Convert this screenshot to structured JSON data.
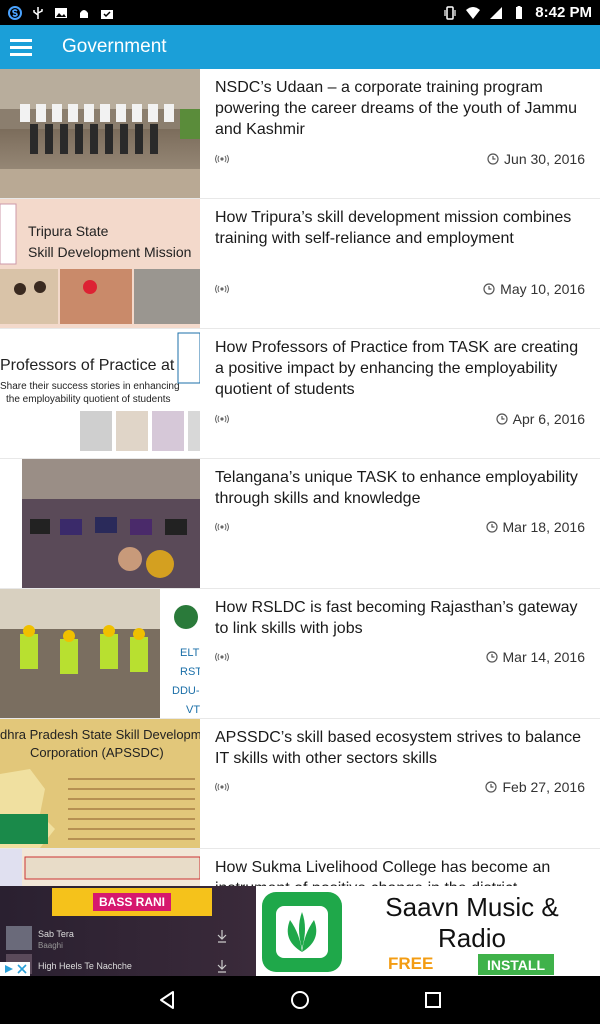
{
  "status_bar": {
    "time": "8:42 PM",
    "icons_left": [
      "app-s-icon",
      "usb-icon",
      "photo-icon",
      "android-icon",
      "briefcase-icon"
    ],
    "icons_right": [
      "vibrate-icon",
      "wifi-icon",
      "signal-icon",
      "battery-icon"
    ]
  },
  "app_bar": {
    "title": "Government",
    "menu_icon": "hamburger-menu-icon"
  },
  "articles": [
    {
      "title": "NSDC’s Udaan – a corporate training program powering the career dreams of the youth of Jammu and Kashmir",
      "date": "Jun 30, 2016"
    },
    {
      "title": "How Tripura’s skill development mission combines training with self-reliance and employment",
      "date": "May 10, 2016",
      "thumb_lines": [
        "Tripura State",
        "Skill Development Mission"
      ]
    },
    {
      "title": "How Professors of Practice from TASK are creating a positive impact by enhancing the employability quotient of students",
      "date": "Apr 6, 2016",
      "thumb_lines": [
        "Professors of Practice at",
        "Share their success stories in enhancing",
        "the employability quotient of students"
      ]
    },
    {
      "title": "Telangana’s unique TASK to enhance employability through skills and knowledge",
      "date": "Mar 18, 2016"
    },
    {
      "title": "How RSLDC is fast becoming Rajasthan’s gateway to link skills with jobs",
      "date": "Mar 14, 2016"
    },
    {
      "title": "APSSDC’s skill based ecosystem strives to balance IT skills with other sectors skills",
      "date": "Feb 27, 2016",
      "thumb_lines": [
        "dhra Pradesh State Skill Developmen",
        "Corporation (APSSDC)"
      ]
    },
    {
      "title": "How Sukma Livelihood College has become an instrument of positive change in the district",
      "date": ""
    }
  ],
  "ad": {
    "title": "Saavn Music & Radio",
    "free_label": "FREE",
    "install_label": "INSTALL",
    "banner_text": "BASS RANI",
    "songs": [
      {
        "title": "Sab Tera",
        "artist": "Baaghi"
      },
      {
        "title": "High Heels Te Nachche",
        "artist": ""
      }
    ]
  },
  "nav_bar": {
    "buttons": [
      "back-icon",
      "home-icon",
      "recents-icon"
    ]
  },
  "colors": {
    "app_bar": "#1b9fd8",
    "status_bar": "#000000",
    "nav_bar": "#000000",
    "install_button": "#3fb24a",
    "free_text": "#f39c12"
  }
}
